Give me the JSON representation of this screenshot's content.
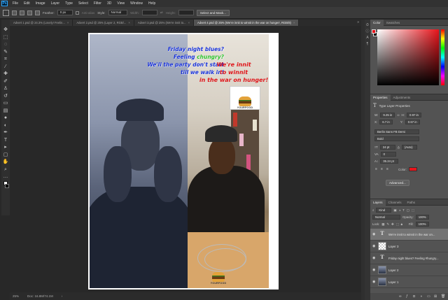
{
  "menu": {
    "logo": "Ps",
    "items": [
      "File",
      "Edit",
      "Image",
      "Layer",
      "Type",
      "Select",
      "Filter",
      "3D",
      "View",
      "Window",
      "Help"
    ]
  },
  "options": {
    "feather_label": "Feather:",
    "feather_value": "0 px",
    "anti_alias_label": "Anti-alias",
    "style_label": "Style:",
    "style_value": "Normal",
    "width_label": "Width:",
    "height_label": "Height:",
    "select_mask_label": "Select and Mask..."
  },
  "tabs": [
    {
      "label": "Advert 1.psd @ 24.3% (Lovely! Feelin..."
    },
    {
      "label": "Advert 2.psd @ 25% (Layer 2, RGB/..."
    },
    {
      "label": "Advert 3.psd @ 25% (We're innit  to..."
    },
    {
      "label": "Advert 4.psd @ 25% (We're innit   to winnit   in the war on hunger!, RGB/8)"
    }
  ],
  "active_tab_index": 3,
  "canvas": {
    "left_text": {
      "line1": "Friday night blues?",
      "line2a": "Feeling ",
      "line2b": "chungry?",
      "line3": "We'll the party don't start",
      "line4": "till we walk in!"
    },
    "right_text": {
      "line1": "We're innit",
      "line2": "to winnit",
      "line3": "in the war on hunger!"
    },
    "logo_text": "YOURFOOD"
  },
  "status": {
    "zoom": "25%",
    "doc": "Doc: 16.8M/74.1M"
  },
  "color_panel": {
    "tabs": [
      "Color",
      "Swatches"
    ],
    "foreground": "#e8141b"
  },
  "properties": {
    "tabs": [
      "Properties",
      "Adjustments"
    ],
    "title": "Type Layer Properties",
    "w_label": "W:",
    "w_value": "9.25 in",
    "h_label": "H:",
    "h_value": "0.97 in",
    "x_label": "X:",
    "x_value": "6.7 in",
    "y_label": "Y:",
    "y_value": "0.67 in",
    "font_family": "Berlin Sans FB Demi",
    "font_style": "Bold",
    "font_size": "24 pt",
    "leading": "(Auto)",
    "tracking_label": "VA",
    "tracking_value": "0",
    "scale_value": "35.24 pt",
    "color_label": "Color:",
    "advanced_label": "Advanced..."
  },
  "layers": {
    "tabs": [
      "Layers",
      "Channels",
      "Paths"
    ],
    "kind_label": "Kind",
    "blend_mode": "Normal",
    "opacity_label": "Opacity:",
    "opacity_value": "100%",
    "lock_label": "Lock:",
    "fill_label": "Fill:",
    "fill_value": "100%",
    "items": [
      {
        "name": "We're innit   to winnit   in the war on...",
        "kind": "text",
        "selected": true
      },
      {
        "name": "Layer 3",
        "kind": "checker",
        "selected": false
      },
      {
        "name": "Friday night blues?  Feeling #hungry...",
        "kind": "text",
        "selected": false
      },
      {
        "name": "Layer 2",
        "kind": "photo",
        "selected": false
      },
      {
        "name": "Layer 1",
        "kind": "photo",
        "selected": false
      }
    ]
  }
}
